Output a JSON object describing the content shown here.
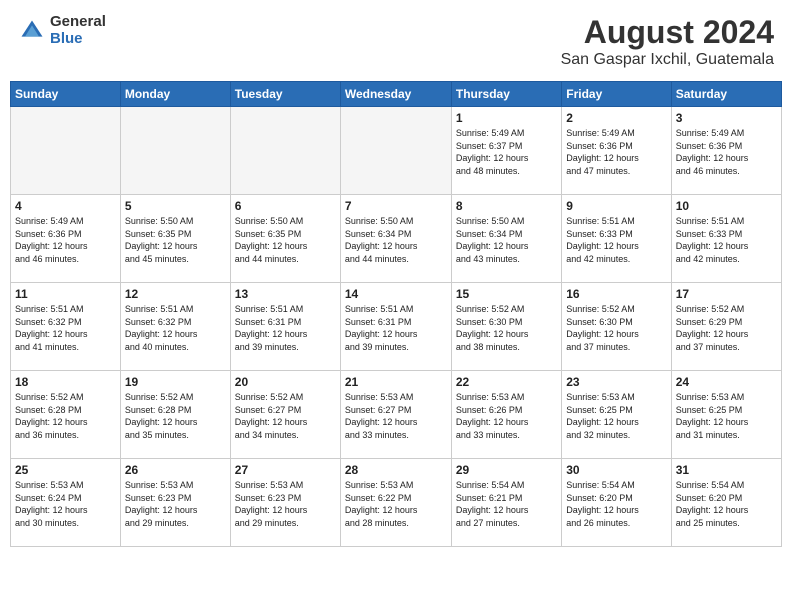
{
  "header": {
    "logo_general": "General",
    "logo_blue": "Blue",
    "title": "August 2024",
    "subtitle": "San Gaspar Ixchil, Guatemala"
  },
  "weekdays": [
    "Sunday",
    "Monday",
    "Tuesday",
    "Wednesday",
    "Thursday",
    "Friday",
    "Saturday"
  ],
  "weeks": [
    [
      {
        "day": "",
        "info": ""
      },
      {
        "day": "",
        "info": ""
      },
      {
        "day": "",
        "info": ""
      },
      {
        "day": "",
        "info": ""
      },
      {
        "day": "1",
        "info": "Sunrise: 5:49 AM\nSunset: 6:37 PM\nDaylight: 12 hours\nand 48 minutes."
      },
      {
        "day": "2",
        "info": "Sunrise: 5:49 AM\nSunset: 6:36 PM\nDaylight: 12 hours\nand 47 minutes."
      },
      {
        "day": "3",
        "info": "Sunrise: 5:49 AM\nSunset: 6:36 PM\nDaylight: 12 hours\nand 46 minutes."
      }
    ],
    [
      {
        "day": "4",
        "info": "Sunrise: 5:49 AM\nSunset: 6:36 PM\nDaylight: 12 hours\nand 46 minutes."
      },
      {
        "day": "5",
        "info": "Sunrise: 5:50 AM\nSunset: 6:35 PM\nDaylight: 12 hours\nand 45 minutes."
      },
      {
        "day": "6",
        "info": "Sunrise: 5:50 AM\nSunset: 6:35 PM\nDaylight: 12 hours\nand 44 minutes."
      },
      {
        "day": "7",
        "info": "Sunrise: 5:50 AM\nSunset: 6:34 PM\nDaylight: 12 hours\nand 44 minutes."
      },
      {
        "day": "8",
        "info": "Sunrise: 5:50 AM\nSunset: 6:34 PM\nDaylight: 12 hours\nand 43 minutes."
      },
      {
        "day": "9",
        "info": "Sunrise: 5:51 AM\nSunset: 6:33 PM\nDaylight: 12 hours\nand 42 minutes."
      },
      {
        "day": "10",
        "info": "Sunrise: 5:51 AM\nSunset: 6:33 PM\nDaylight: 12 hours\nand 42 minutes."
      }
    ],
    [
      {
        "day": "11",
        "info": "Sunrise: 5:51 AM\nSunset: 6:32 PM\nDaylight: 12 hours\nand 41 minutes."
      },
      {
        "day": "12",
        "info": "Sunrise: 5:51 AM\nSunset: 6:32 PM\nDaylight: 12 hours\nand 40 minutes."
      },
      {
        "day": "13",
        "info": "Sunrise: 5:51 AM\nSunset: 6:31 PM\nDaylight: 12 hours\nand 39 minutes."
      },
      {
        "day": "14",
        "info": "Sunrise: 5:51 AM\nSunset: 6:31 PM\nDaylight: 12 hours\nand 39 minutes."
      },
      {
        "day": "15",
        "info": "Sunrise: 5:52 AM\nSunset: 6:30 PM\nDaylight: 12 hours\nand 38 minutes."
      },
      {
        "day": "16",
        "info": "Sunrise: 5:52 AM\nSunset: 6:30 PM\nDaylight: 12 hours\nand 37 minutes."
      },
      {
        "day": "17",
        "info": "Sunrise: 5:52 AM\nSunset: 6:29 PM\nDaylight: 12 hours\nand 37 minutes."
      }
    ],
    [
      {
        "day": "18",
        "info": "Sunrise: 5:52 AM\nSunset: 6:28 PM\nDaylight: 12 hours\nand 36 minutes."
      },
      {
        "day": "19",
        "info": "Sunrise: 5:52 AM\nSunset: 6:28 PM\nDaylight: 12 hours\nand 35 minutes."
      },
      {
        "day": "20",
        "info": "Sunrise: 5:52 AM\nSunset: 6:27 PM\nDaylight: 12 hours\nand 34 minutes."
      },
      {
        "day": "21",
        "info": "Sunrise: 5:53 AM\nSunset: 6:27 PM\nDaylight: 12 hours\nand 33 minutes."
      },
      {
        "day": "22",
        "info": "Sunrise: 5:53 AM\nSunset: 6:26 PM\nDaylight: 12 hours\nand 33 minutes."
      },
      {
        "day": "23",
        "info": "Sunrise: 5:53 AM\nSunset: 6:25 PM\nDaylight: 12 hours\nand 32 minutes."
      },
      {
        "day": "24",
        "info": "Sunrise: 5:53 AM\nSunset: 6:25 PM\nDaylight: 12 hours\nand 31 minutes."
      }
    ],
    [
      {
        "day": "25",
        "info": "Sunrise: 5:53 AM\nSunset: 6:24 PM\nDaylight: 12 hours\nand 30 minutes."
      },
      {
        "day": "26",
        "info": "Sunrise: 5:53 AM\nSunset: 6:23 PM\nDaylight: 12 hours\nand 29 minutes."
      },
      {
        "day": "27",
        "info": "Sunrise: 5:53 AM\nSunset: 6:23 PM\nDaylight: 12 hours\nand 29 minutes."
      },
      {
        "day": "28",
        "info": "Sunrise: 5:53 AM\nSunset: 6:22 PM\nDaylight: 12 hours\nand 28 minutes."
      },
      {
        "day": "29",
        "info": "Sunrise: 5:54 AM\nSunset: 6:21 PM\nDaylight: 12 hours\nand 27 minutes."
      },
      {
        "day": "30",
        "info": "Sunrise: 5:54 AM\nSunset: 6:20 PM\nDaylight: 12 hours\nand 26 minutes."
      },
      {
        "day": "31",
        "info": "Sunrise: 5:54 AM\nSunset: 6:20 PM\nDaylight: 12 hours\nand 25 minutes."
      }
    ]
  ]
}
